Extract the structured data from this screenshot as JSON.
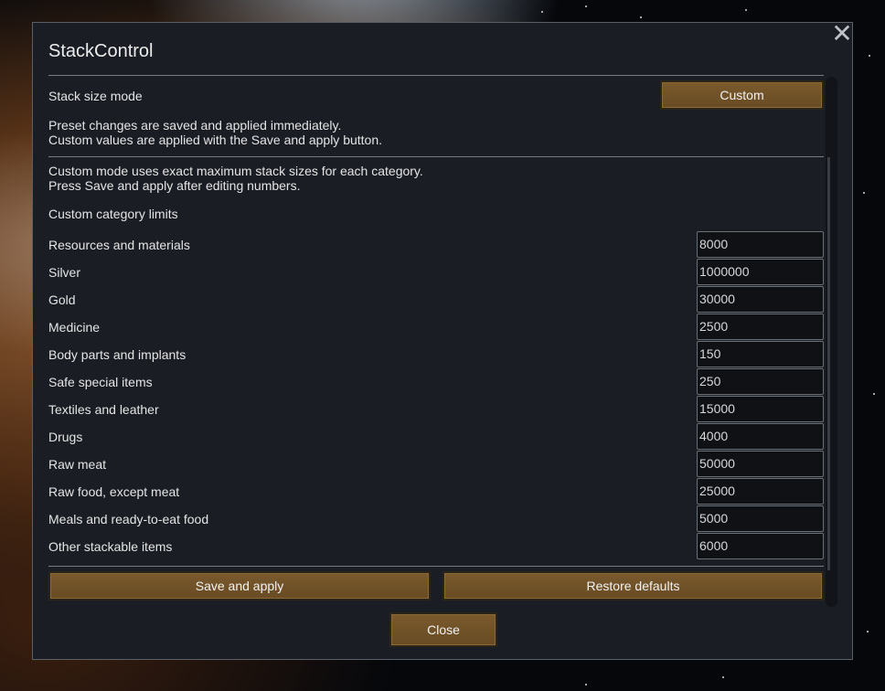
{
  "dialog": {
    "title": "StackControl",
    "close_glyph": "✕"
  },
  "mode": {
    "label": "Stack size mode",
    "selected": "Custom"
  },
  "notes": {
    "preset_line1": "Preset changes are saved and applied immediately.",
    "preset_line2": "Custom values are applied with the Save and apply button.",
    "custom_line1": "Custom mode uses exact maximum stack sizes for each category.",
    "custom_line2": "Press Save and apply after editing numbers."
  },
  "section_title": "Custom category limits",
  "categories": [
    {
      "label": "Resources and materials",
      "value": "8000"
    },
    {
      "label": "Silver",
      "value": "1000000"
    },
    {
      "label": "Gold",
      "value": "30000"
    },
    {
      "label": "Medicine",
      "value": "2500"
    },
    {
      "label": "Body parts and implants",
      "value": "150"
    },
    {
      "label": "Safe special items",
      "value": "250"
    },
    {
      "label": "Textiles and leather",
      "value": "15000"
    },
    {
      "label": "Drugs",
      "value": "4000"
    },
    {
      "label": "Raw meat",
      "value": "50000"
    },
    {
      "label": "Raw food, except meat",
      "value": "25000"
    },
    {
      "label": "Meals and ready-to-eat food",
      "value": "5000"
    },
    {
      "label": "Other stackable items",
      "value": "6000"
    }
  ],
  "buttons": {
    "save": "Save and apply",
    "restore": "Restore defaults",
    "close": "Close"
  },
  "colors": {
    "button_wood": "#6f5127",
    "panel": "#1a1e24",
    "field_bg": "#0f1115"
  }
}
